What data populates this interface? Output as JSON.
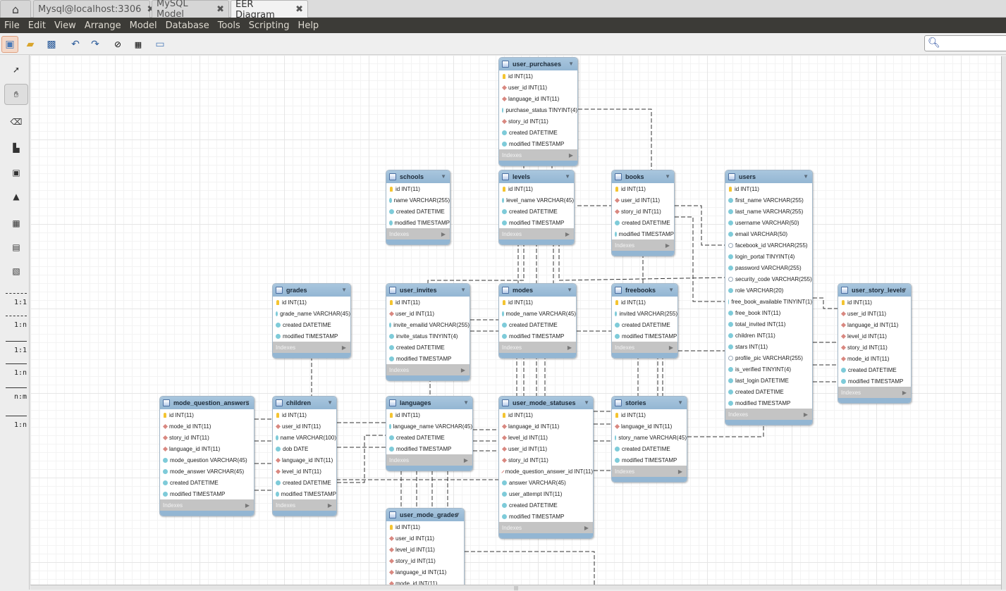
{
  "tabs": [
    {
      "label": "Mysql@localhost:3306",
      "close": "✖"
    },
    {
      "label": "MySQL Model",
      "close": "✖"
    },
    {
      "label": "EER Diagram",
      "close": "✖",
      "active": true
    }
  ],
  "menu": [
    "File",
    "Edit",
    "View",
    "Arrange",
    "Model",
    "Database",
    "Tools",
    "Scripting",
    "Help"
  ],
  "toolbar": {
    "buttons": [
      "new-model-icon",
      "open-icon",
      "save-icon",
      "undo-icon",
      "redo-icon",
      "toggle-grid-icon",
      "align-grid-icon",
      "new-diagram-icon"
    ],
    "search_placeholder": ""
  },
  "palette": {
    "tools": [
      "pointer-icon",
      "hand-icon",
      "eraser-icon",
      "layer-icon",
      "note-icon",
      "image-icon",
      "table-icon",
      "view-icon",
      "routine-group-icon"
    ],
    "relationships": [
      {
        "label": "1:1",
        "style": "dashed",
        "kind": "one-to-one-non-identifying"
      },
      {
        "label": "1:n",
        "style": "dashed",
        "kind": "one-to-many-non-identifying"
      },
      {
        "label": "1:1",
        "style": "solid",
        "kind": "one-to-one-identifying"
      },
      {
        "label": "1:n",
        "style": "solid",
        "kind": "one-to-many-identifying"
      },
      {
        "label": "n:m",
        "style": "solid",
        "kind": "many-to-many"
      },
      {
        "label": "1:n",
        "style": "solid",
        "kind": "existing-columns"
      }
    ]
  },
  "indexes_label": "Indexes",
  "tables": [
    {
      "name": "user_purchases",
      "columns": [
        {
          "t": "pk",
          "n": "id INT(11)"
        },
        {
          "t": "fk",
          "n": "user_id INT(11)"
        },
        {
          "t": "fk",
          "n": "language_id INT(11)"
        },
        {
          "t": "nn",
          "n": "purchase_status TINYINT(4)"
        },
        {
          "t": "fk",
          "n": "story_id INT(11)"
        },
        {
          "t": "nn",
          "n": "created DATETIME"
        },
        {
          "t": "nn",
          "n": "modified TIMESTAMP"
        }
      ]
    },
    {
      "name": "schools",
      "columns": [
        {
          "t": "pk",
          "n": "id INT(11)"
        },
        {
          "t": "nn",
          "n": "name VARCHAR(255)"
        },
        {
          "t": "nn",
          "n": "created DATETIME"
        },
        {
          "t": "nn",
          "n": "modified TIMESTAMP"
        }
      ]
    },
    {
      "name": "levels",
      "columns": [
        {
          "t": "pk",
          "n": "id INT(11)"
        },
        {
          "t": "nn",
          "n": "level_name VARCHAR(45)"
        },
        {
          "t": "nn",
          "n": "created DATETIME"
        },
        {
          "t": "nn",
          "n": "modified TIMESTAMP"
        }
      ]
    },
    {
      "name": "books",
      "columns": [
        {
          "t": "pk",
          "n": "id INT(11)"
        },
        {
          "t": "fk",
          "n": "user_id INT(11)"
        },
        {
          "t": "fk",
          "n": "story_id INT(11)"
        },
        {
          "t": "nn",
          "n": "created DATETIME"
        },
        {
          "t": "nn",
          "n": "modified TIMESTAMP"
        }
      ]
    },
    {
      "name": "users",
      "columns": [
        {
          "t": "pk",
          "n": "id INT(11)"
        },
        {
          "t": "nn",
          "n": "first_name VARCHAR(255)"
        },
        {
          "t": "nn",
          "n": "last_name VARCHAR(255)"
        },
        {
          "t": "nn",
          "n": "username VARCHAR(50)"
        },
        {
          "t": "nn",
          "n": "email VARCHAR(50)"
        },
        {
          "t": "nl",
          "n": "facebook_id VARCHAR(255)"
        },
        {
          "t": "nn",
          "n": "login_portal TINYINT(4)"
        },
        {
          "t": "nn",
          "n": "password VARCHAR(255)"
        },
        {
          "t": "nl",
          "n": "security_code VARCHAR(255)"
        },
        {
          "t": "nn",
          "n": "role VARCHAR(20)"
        },
        {
          "t": "nn",
          "n": "free_book_available TINYINT(1)"
        },
        {
          "t": "nn",
          "n": "free_book INT(11)"
        },
        {
          "t": "nn",
          "n": "total_invited INT(11)"
        },
        {
          "t": "nn",
          "n": "children INT(11)"
        },
        {
          "t": "nn",
          "n": "stars INT(11)"
        },
        {
          "t": "nl",
          "n": "profile_pic VARCHAR(255)"
        },
        {
          "t": "nn",
          "n": "is_verified TINYINT(4)"
        },
        {
          "t": "nn",
          "n": "last_login DATETIME"
        },
        {
          "t": "nn",
          "n": "created DATETIME"
        },
        {
          "t": "nn",
          "n": "modified TIMESTAMP"
        }
      ]
    },
    {
      "name": "grades",
      "columns": [
        {
          "t": "pk",
          "n": "id INT(11)"
        },
        {
          "t": "nn",
          "n": "grade_name VARCHAR(45)"
        },
        {
          "t": "nn",
          "n": "created DATETIME"
        },
        {
          "t": "nn",
          "n": "modified TIMESTAMP"
        }
      ]
    },
    {
      "name": "user_invites",
      "columns": [
        {
          "t": "pk",
          "n": "id INT(11)"
        },
        {
          "t": "fk",
          "n": "user_id INT(11)"
        },
        {
          "t": "nn",
          "n": "invite_emailid VARCHAR(255)"
        },
        {
          "t": "nn",
          "n": "invite_status TINYINT(4)"
        },
        {
          "t": "nn",
          "n": "created DATETIME"
        },
        {
          "t": "nn",
          "n": "modified TIMESTAMP"
        }
      ]
    },
    {
      "name": "modes",
      "columns": [
        {
          "t": "pk",
          "n": "id INT(11)"
        },
        {
          "t": "nn",
          "n": "mode_name VARCHAR(45)"
        },
        {
          "t": "nn",
          "n": "created DATETIME"
        },
        {
          "t": "nn",
          "n": "modified TIMESTAMP"
        }
      ]
    },
    {
      "name": "freebooks",
      "columns": [
        {
          "t": "pk",
          "n": "id INT(11)"
        },
        {
          "t": "nn",
          "n": "invited VARCHAR(255)"
        },
        {
          "t": "nn",
          "n": "created DATETIME"
        },
        {
          "t": "nn",
          "n": "modified TIMESTAMP"
        }
      ]
    },
    {
      "name": "user_story_levels",
      "columns": [
        {
          "t": "pk",
          "n": "id INT(11)"
        },
        {
          "t": "fk",
          "n": "user_id INT(11)"
        },
        {
          "t": "fk",
          "n": "language_id INT(11)"
        },
        {
          "t": "fk",
          "n": "level_id INT(11)"
        },
        {
          "t": "fk",
          "n": "story_id INT(11)"
        },
        {
          "t": "fk",
          "n": "mode_id INT(11)"
        },
        {
          "t": "nn",
          "n": "created DATETIME"
        },
        {
          "t": "nn",
          "n": "modified TIMESTAMP"
        }
      ]
    },
    {
      "name": "mode_question_answers",
      "columns": [
        {
          "t": "pk",
          "n": "id INT(11)"
        },
        {
          "t": "fk",
          "n": "mode_id INT(11)"
        },
        {
          "t": "fk",
          "n": "story_id INT(11)"
        },
        {
          "t": "fk",
          "n": "language_id INT(11)"
        },
        {
          "t": "nn",
          "n": "mode_question VARCHAR(45)"
        },
        {
          "t": "nn",
          "n": "mode_answer VARCHAR(45)"
        },
        {
          "t": "nn",
          "n": "created DATETIME"
        },
        {
          "t": "nn",
          "n": "modified TIMESTAMP"
        }
      ]
    },
    {
      "name": "children",
      "columns": [
        {
          "t": "pk",
          "n": "id INT(11)"
        },
        {
          "t": "fk",
          "n": "user_id INT(11)"
        },
        {
          "t": "nn",
          "n": "name VARCHAR(100)"
        },
        {
          "t": "nn",
          "n": "dob DATE"
        },
        {
          "t": "fk",
          "n": "language_id INT(11)"
        },
        {
          "t": "fk",
          "n": "level_id INT(11)"
        },
        {
          "t": "nn",
          "n": "created DATETIME"
        },
        {
          "t": "nn",
          "n": "modified TIMESTAMP"
        }
      ]
    },
    {
      "name": "languages",
      "columns": [
        {
          "t": "pk",
          "n": "id INT(11)"
        },
        {
          "t": "nn",
          "n": "language_name VARCHAR(45)"
        },
        {
          "t": "nn",
          "n": "created DATETIME"
        },
        {
          "t": "nn",
          "n": "modified TIMESTAMP"
        }
      ]
    },
    {
      "name": "user_mode_statuses",
      "columns": [
        {
          "t": "pk",
          "n": "id INT(11)"
        },
        {
          "t": "fk",
          "n": "language_id INT(11)"
        },
        {
          "t": "fk",
          "n": "level_id INT(11)"
        },
        {
          "t": "fk",
          "n": "user_id INT(11)"
        },
        {
          "t": "fk",
          "n": "story_id INT(11)"
        },
        {
          "t": "fk",
          "n": "mode_question_answer_id INT(11)"
        },
        {
          "t": "nn",
          "n": "answer VARCHAR(45)"
        },
        {
          "t": "nn",
          "n": "user_attempt INT(11)"
        },
        {
          "t": "nn",
          "n": "created DATETIME"
        },
        {
          "t": "nn",
          "n": "modified TIMESTAMP"
        }
      ]
    },
    {
      "name": "stories",
      "columns": [
        {
          "t": "pk",
          "n": "id INT(11)"
        },
        {
          "t": "fk",
          "n": "language_id INT(11)"
        },
        {
          "t": "nn",
          "n": "story_name VARCHAR(45)"
        },
        {
          "t": "nn",
          "n": "created DATETIME"
        },
        {
          "t": "nn",
          "n": "modified TIMESTAMP"
        }
      ]
    },
    {
      "name": "user_mode_grades",
      "columns": [
        {
          "t": "pk",
          "n": "id INT(11)"
        },
        {
          "t": "fk",
          "n": "user_id INT(11)"
        },
        {
          "t": "fk",
          "n": "level_id INT(11)"
        },
        {
          "t": "fk",
          "n": "story_id INT(11)"
        },
        {
          "t": "fk",
          "n": "language_id INT(11)"
        },
        {
          "t": "fk",
          "n": "mode_id INT(11)"
        }
      ]
    }
  ]
}
